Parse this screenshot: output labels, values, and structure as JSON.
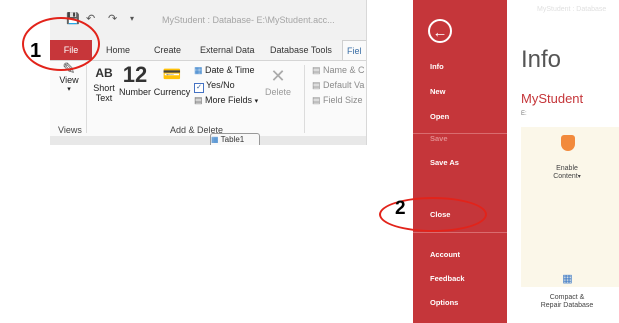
{
  "ribbon": {
    "window_title": "MyStudent : Database- E:\\MyStudent.acc...",
    "tabs": [
      "File",
      "Home",
      "Create",
      "External Data",
      "Database Tools",
      "Fiel"
    ],
    "view": {
      "label": "View"
    },
    "text_ab": {
      "glyph": "AB",
      "label": "Short\nText"
    },
    "number": {
      "glyph": "12",
      "label": "Number"
    },
    "currency": {
      "label": "Currency"
    },
    "datetime": {
      "label": "Date & Time"
    },
    "yesno": {
      "label": "Yes/No"
    },
    "more_fields": {
      "label": "More Fields"
    },
    "delete": {
      "label": "Delete"
    },
    "name_caption": {
      "label": "Name & C"
    },
    "default_value": {
      "label": "Default Va"
    },
    "field_size": {
      "label": "Field Size"
    },
    "group_views": "Views",
    "group_add_delete": "Add & Delete",
    "doc_tab": "Table1"
  },
  "backstage": {
    "faded_header": "MyStudent : Database",
    "menu": {
      "info": "Info",
      "new": "New",
      "open": "Open",
      "save": "Save",
      "save_as": "Save As",
      "close": "Close",
      "account": "Account",
      "feedback": "Feedback",
      "options": "Options"
    },
    "info_title": "Info",
    "db_name": "MyStudent",
    "db_path": "E:",
    "enable_content": "Enable\nContent",
    "compact": "Compact &\nRepair Database"
  },
  "annotations": {
    "step1": "1",
    "step2": "2"
  },
  "colors": {
    "accent_red": "#c5363a",
    "circle_red": "#e2231a"
  }
}
